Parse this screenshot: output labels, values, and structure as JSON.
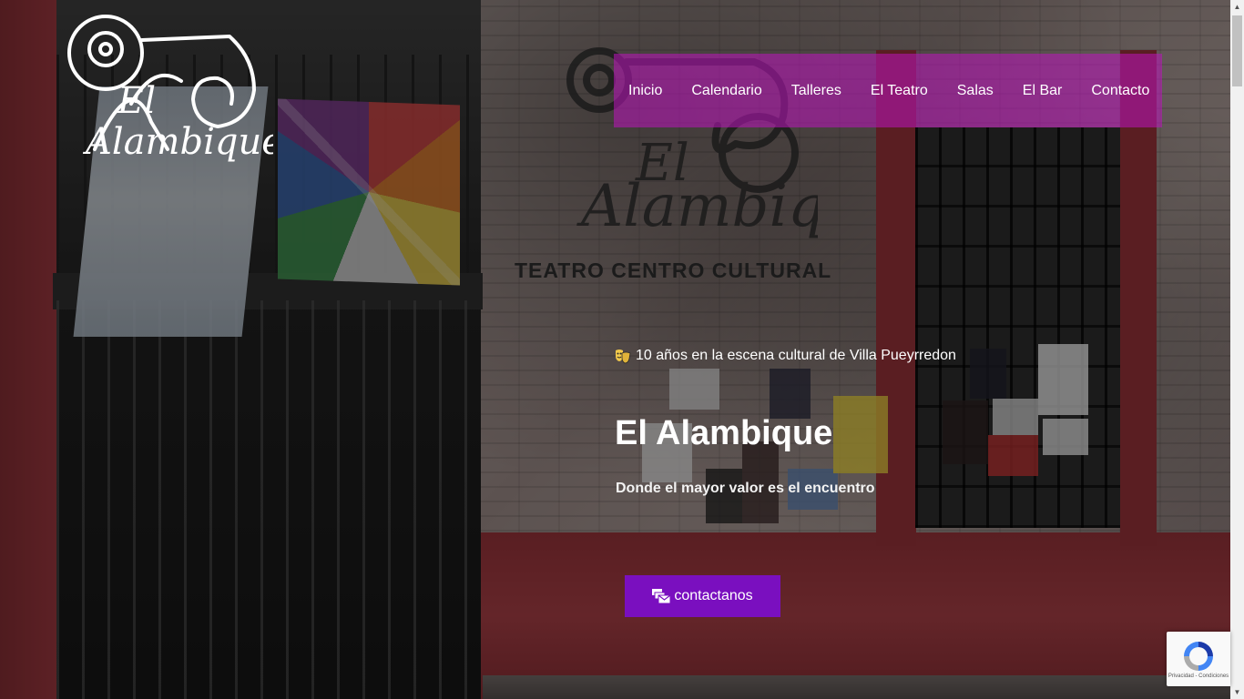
{
  "logo": {
    "line1": "El",
    "line2": "Alambique"
  },
  "nav": {
    "items": [
      {
        "label": "Inicio"
      },
      {
        "label": "Calendario"
      },
      {
        "label": "Talleres"
      },
      {
        "label": "El Teatro"
      },
      {
        "label": "Salas"
      },
      {
        "label": "El Bar"
      },
      {
        "label": "Contacto"
      }
    ]
  },
  "hero": {
    "tagline": "10 años en la escena cultural de Villa Pueyrredon",
    "tagline_icon": "theater-masks-icon",
    "title": "El Alambique",
    "subtitle": "Donde el mayor valor es el encuentro",
    "cta_label": "contactanos",
    "cta_icon": "mail-bulk-icon"
  },
  "background": {
    "wall_sign_line1": "El",
    "wall_sign_line2": "Alambique",
    "wall_sign_line3": "TEATRO   CENTRO CULTURAL"
  },
  "recaptcha": {
    "links": "Privacidad - Condiciones"
  },
  "colors": {
    "nav_background": "#be14be",
    "cta_background": "#7a0fbf",
    "text": "#ffffff"
  }
}
